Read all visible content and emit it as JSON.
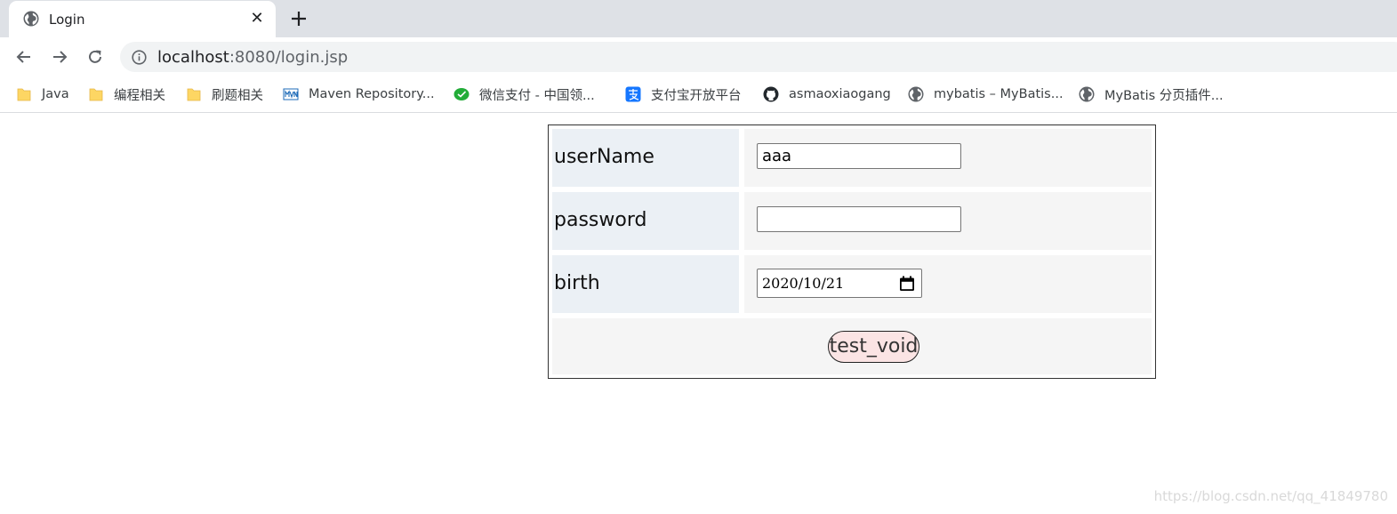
{
  "browser": {
    "tab_title": "Login",
    "url_host": "localhost",
    "url_rest": ":8080/login.jsp",
    "bookmarks": [
      {
        "label": "Java",
        "icon": "folder-icon"
      },
      {
        "label": "编程相关",
        "icon": "folder-icon"
      },
      {
        "label": "刷题相关",
        "icon": "folder-icon"
      },
      {
        "label": "Maven Repository...",
        "icon": "maven-icon"
      },
      {
        "label": "微信支付 - 中国领...",
        "icon": "wechat-icon"
      },
      {
        "label": "支付宝开放平台",
        "icon": "alipay-icon"
      },
      {
        "label": "asmaoxiaogang",
        "icon": "github-icon"
      },
      {
        "label": "mybatis – MyBatis...",
        "icon": "globe-icon"
      },
      {
        "label": "MyBatis 分页插件...",
        "icon": "globe-icon"
      }
    ]
  },
  "form": {
    "username_label": "userName",
    "username_value": "aaa",
    "password_label": "password",
    "password_value": "",
    "birth_label": "birth",
    "birth_value": "2020/10/21",
    "submit_label": "test_void"
  },
  "watermark": "https://blog.csdn.net/qq_41849780",
  "colors": {
    "label_bg": "#ebf0f5",
    "field_bg": "#f5f5f5",
    "button_bg": "#fbe4e4",
    "tabstrip_bg": "#dee1e6"
  }
}
